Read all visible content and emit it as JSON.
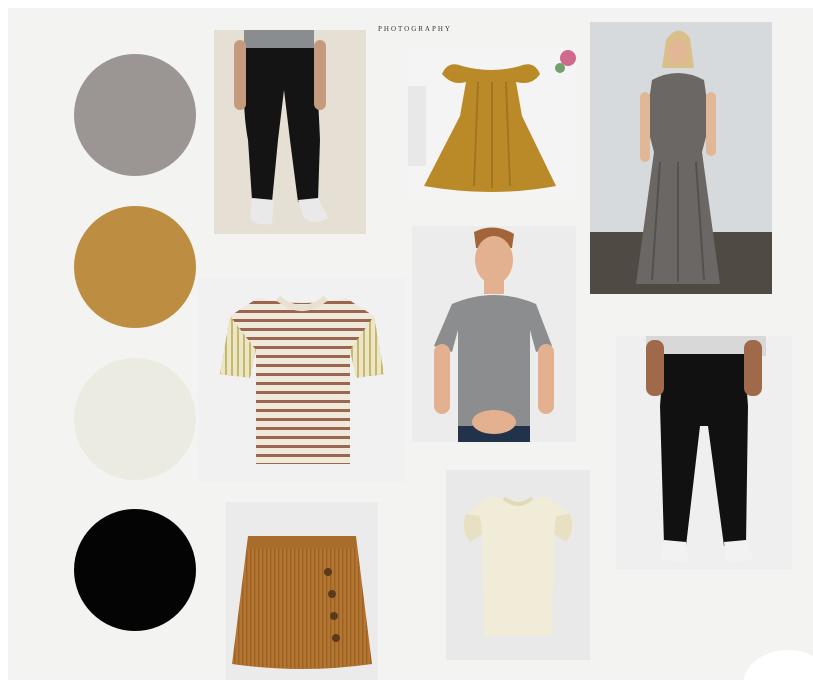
{
  "logo": {
    "script": "",
    "subtitle": "PHOTOGRAPHY"
  },
  "palette": [
    {
      "name": "gray",
      "color": "#9b9593"
    },
    {
      "name": "mustard",
      "color": "#bd8d42"
    },
    {
      "name": "cream",
      "color": "#ecebe1"
    },
    {
      "name": "black",
      "color": "#040404"
    }
  ],
  "photos": [
    {
      "name": "black-joggers-photo",
      "icon": "black-joggers"
    },
    {
      "name": "mustard-dress-photo",
      "icon": "mustard-dress"
    },
    {
      "name": "gray-maxi-dress-photo",
      "icon": "gray-maxi-dress"
    },
    {
      "name": "striped-tee-photo",
      "icon": "striped-tee"
    },
    {
      "name": "gray-henley-man-photo",
      "icon": "gray-henley"
    },
    {
      "name": "black-pants-photo",
      "icon": "black-pants"
    },
    {
      "name": "corduroy-skirt-photo",
      "icon": "corduroy-skirt"
    },
    {
      "name": "cream-flutter-tee-photo",
      "icon": "cream-flutter-tee"
    }
  ]
}
